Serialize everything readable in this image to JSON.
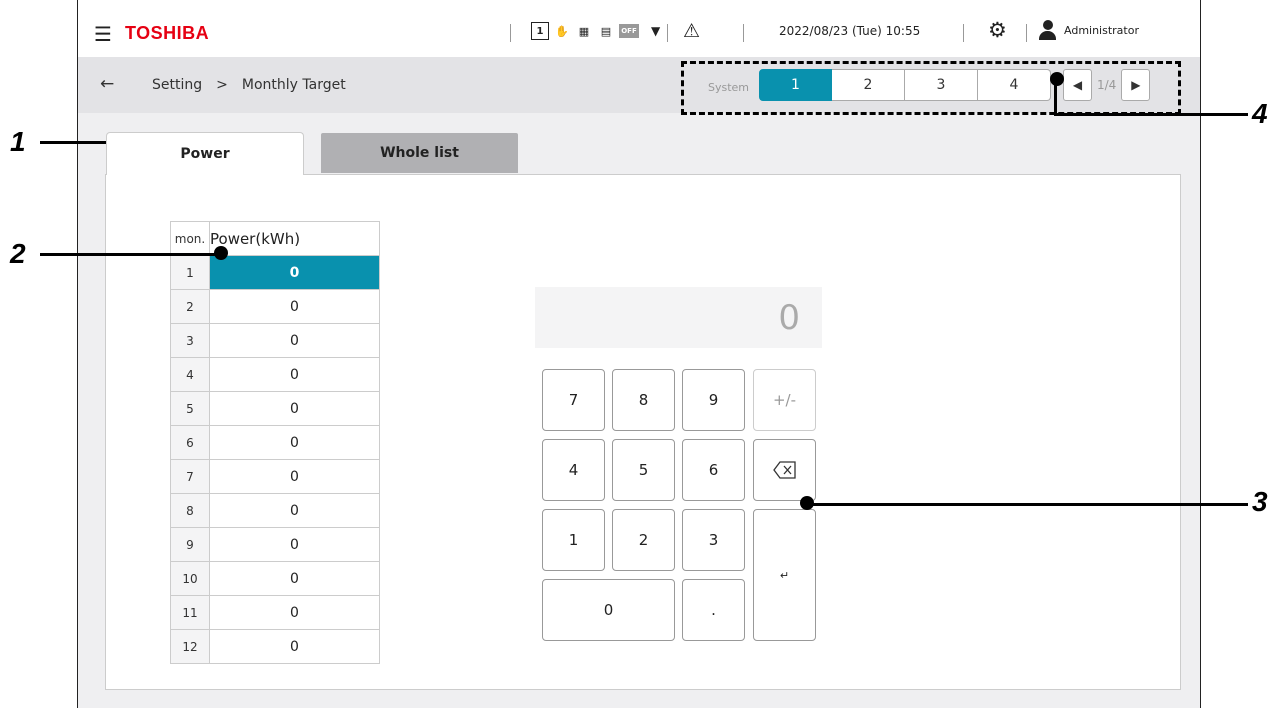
{
  "header": {
    "brand": "TOSHIBA",
    "status_icons": [
      {
        "name": "schedule-1-icon",
        "glyph": "1"
      },
      {
        "name": "hand-icon",
        "glyph": "✋"
      },
      {
        "name": "calendar-off-icon",
        "glyph": "▦"
      },
      {
        "name": "group-icon",
        "glyph": "▤"
      },
      {
        "name": "off-badge-icon",
        "glyph": "OFF"
      }
    ],
    "datetime": "2022/08/23 (Tue) 10:55",
    "user": "Administrator"
  },
  "breadcrumb": {
    "items": [
      "Setting",
      ">",
      "Monthly Target"
    ]
  },
  "system": {
    "label": "System",
    "buttons": [
      "1",
      "2",
      "3",
      "4"
    ],
    "active": "1",
    "page": "1/4"
  },
  "tabs": [
    {
      "label": "Power",
      "active": true
    },
    {
      "label": "Whole list",
      "active": false
    }
  ],
  "table": {
    "headers": {
      "month": "mon.",
      "power": "Power(kWh)"
    },
    "rows": [
      {
        "mon": "1",
        "value": "0"
      },
      {
        "mon": "2",
        "value": "0"
      },
      {
        "mon": "3",
        "value": "0"
      },
      {
        "mon": "4",
        "value": "0"
      },
      {
        "mon": "5",
        "value": "0"
      },
      {
        "mon": "6",
        "value": "0"
      },
      {
        "mon": "7",
        "value": "0"
      },
      {
        "mon": "8",
        "value": "0"
      },
      {
        "mon": "9",
        "value": "0"
      },
      {
        "mon": "10",
        "value": "0"
      },
      {
        "mon": "11",
        "value": "0"
      },
      {
        "mon": "12",
        "value": "0"
      }
    ],
    "selected_row": 1
  },
  "keypad": {
    "display": "0",
    "keys": {
      "k7": "7",
      "k8": "8",
      "k9": "9",
      "pm": "+/-",
      "k4": "4",
      "k5": "5",
      "k6": "6",
      "k1": "1",
      "k2": "2",
      "k3": "3",
      "k0": "0",
      "dot": ".",
      "enter": "↵"
    }
  },
  "callouts": [
    "1",
    "2",
    "3",
    "4"
  ],
  "colors": {
    "accent": "#0991ae",
    "brand": "#e60012"
  }
}
